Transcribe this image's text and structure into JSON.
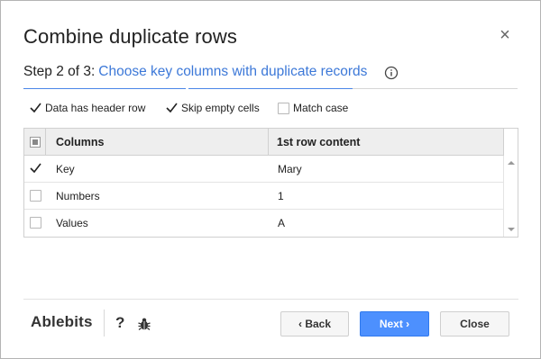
{
  "dialog": {
    "title": "Combine duplicate rows",
    "close_glyph": "×"
  },
  "step": {
    "number_text": "Step 2 of 3:",
    "description": "Choose key columns with duplicate records",
    "info_icon": "info-icon"
  },
  "options": [
    {
      "label": "Data has header row",
      "checked": true
    },
    {
      "label": "Skip empty cells",
      "checked": true
    },
    {
      "label": "Match case",
      "checked": false
    }
  ],
  "grid": {
    "headers": {
      "columns": "Columns",
      "first_row": "1st row content"
    },
    "select_all_state": "partial",
    "rows": [
      {
        "column": "Key",
        "content": "Mary",
        "checked": true
      },
      {
        "column": "Numbers",
        "content": "1",
        "checked": false
      },
      {
        "column": "Values",
        "content": "A",
        "checked": false
      }
    ]
  },
  "footer": {
    "brand": "Ablebits",
    "help_label": "?",
    "bug_icon": "bug-icon",
    "back_label": "‹ Back",
    "next_label": "Next ›",
    "close_label": "Close"
  },
  "colors": {
    "accent": "#4a86e8",
    "link": "#3c78d8",
    "primary_button": "#4d90fe"
  }
}
